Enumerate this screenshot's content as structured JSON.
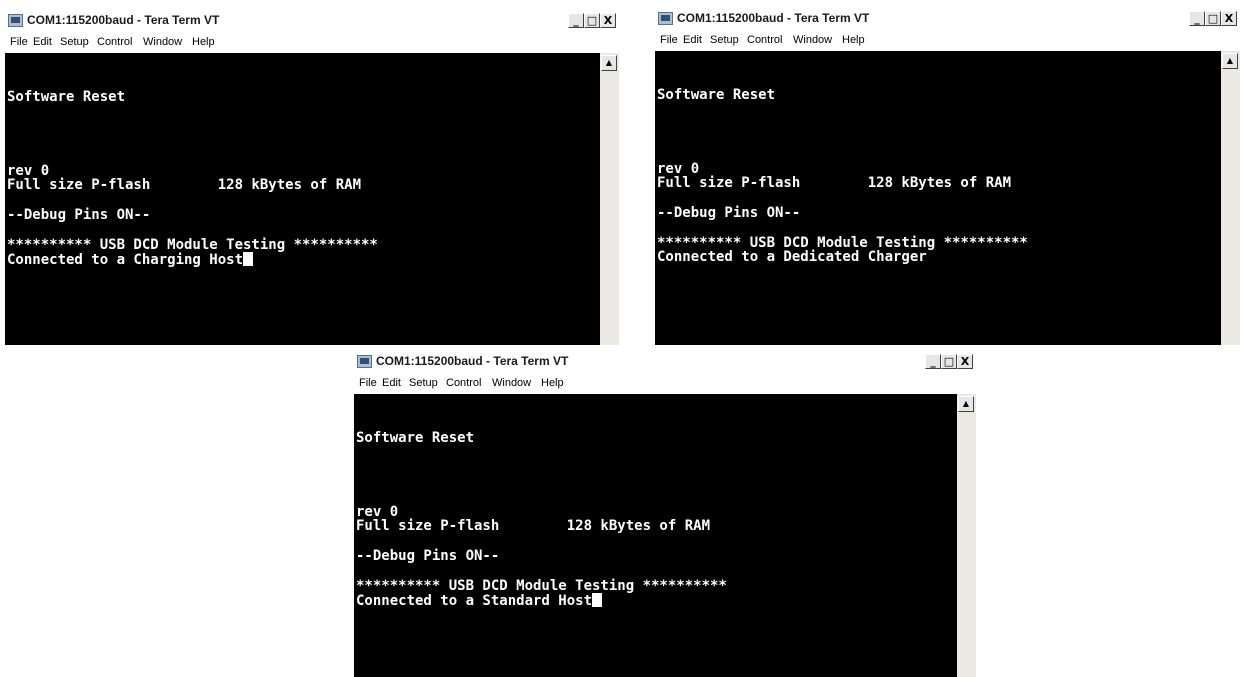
{
  "windows": [
    {
      "title": "COM1:115200baud - Tera Term VT",
      "controls": {
        "minimize": "_",
        "maximize": "□",
        "close": "X"
      },
      "menu": [
        "File",
        "Edit",
        "Setup",
        "Control",
        "Window",
        "Help"
      ],
      "scroll_up": "▲",
      "terminal": {
        "lines": [
          "",
          "",
          "Software Reset",
          "",
          "",
          "",
          "",
          "rev 0",
          "Full size P-flash        128 kBytes of RAM",
          "",
          "--Debug Pins ON--",
          "",
          "********** USB DCD Module Testing **********",
          "Connected to a Charging Host"
        ],
        "cursor": true
      }
    },
    {
      "title": "COM1:115200baud - Tera Term VT",
      "controls": {
        "minimize": "_",
        "maximize": "□",
        "close": "X"
      },
      "menu": [
        "File",
        "Edit",
        "Setup",
        "Control",
        "Window",
        "Help"
      ],
      "scroll_up": "▲",
      "terminal": {
        "lines": [
          "",
          "",
          "Software Reset",
          "",
          "",
          "",
          "",
          "rev 0",
          "Full size P-flash        128 kBytes of RAM",
          "",
          "--Debug Pins ON--",
          "",
          "********** USB DCD Module Testing **********",
          "Connected to a Dedicated Charger"
        ],
        "cursor": false
      }
    },
    {
      "title": "COM1:115200baud - Tera Term VT",
      "controls": {
        "minimize": "_",
        "maximize": "□",
        "close": "X"
      },
      "menu": [
        "File",
        "Edit",
        "Setup",
        "Control",
        "Window",
        "Help"
      ],
      "scroll_up": "▲",
      "terminal": {
        "lines": [
          "",
          "",
          "Software Reset",
          "",
          "",
          "",
          "",
          "rev 0",
          "Full size P-flash        128 kBytes of RAM",
          "",
          "--Debug Pins ON--",
          "",
          "********** USB DCD Module Testing **********",
          "Connected to a Standard Host"
        ],
        "cursor": true
      }
    }
  ]
}
